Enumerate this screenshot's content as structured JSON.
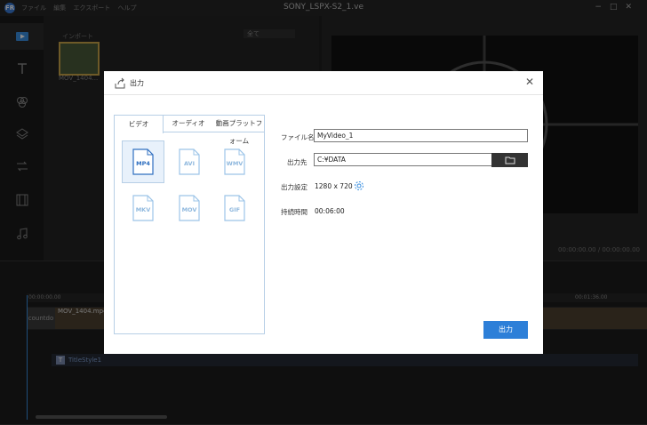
{
  "app": {
    "title": "SONY_LSPX-S2_1.ve",
    "logo_text": "FR",
    "menu": [
      "ファイル",
      "編集",
      "エクスポート",
      "ヘルプ"
    ]
  },
  "media": {
    "tab_label": "インポート",
    "filter_label": "全て",
    "thumb_label": "MOV_1404..."
  },
  "preview": {
    "time": "00:00:00.00 / 00:00:00.00"
  },
  "timeline": {
    "ruler_start": "00:00:00.00",
    "ruler_mark": "00:01:36.00",
    "clip_a_label": "countdo",
    "clip_b_label": "MOV_1404.mp4",
    "text_clip_label": "TitleStyle1",
    "text_clip_icon": "T"
  },
  "dialog": {
    "title": "出力",
    "close_glyph": "✕",
    "tabs": [
      "ビデオ",
      "オーディオ",
      "動画プラットフォーム"
    ],
    "formats": [
      "MP4",
      "AVI",
      "WMV",
      "MKV",
      "MOV",
      "GIF"
    ],
    "selected_format": "MP4",
    "fields": {
      "filename_label": "ファイル名",
      "filename_value": "MyVideo_1",
      "dest_label": "出力先",
      "dest_value": "C:¥DATA",
      "settings_label": "出力設定",
      "settings_value": "1280 x 720",
      "duration_label": "持続時間",
      "duration_value": "00:06:00"
    },
    "export_label": "出力"
  },
  "colors": {
    "accent": "#2d7fd8",
    "panel_border": "#b7cfe6"
  }
}
